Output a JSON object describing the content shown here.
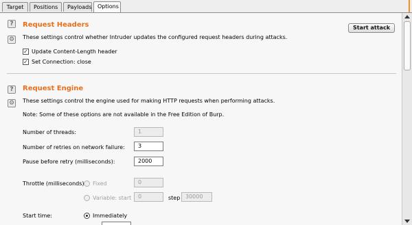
{
  "tabs": [
    {
      "label": "Target",
      "active": false
    },
    {
      "label": "Positions",
      "active": false
    },
    {
      "label": "Payloads",
      "active": false
    },
    {
      "label": "Options",
      "active": true
    }
  ],
  "request_headers": {
    "title": "Request Headers",
    "description": "These settings control whether Intruder updates the configured request headers during attacks.",
    "start_attack_label": "Start attack",
    "options": [
      {
        "label": "Update Content-Length header",
        "checked": true
      },
      {
        "label": "Set Connection: close",
        "checked": true
      }
    ]
  },
  "request_engine": {
    "title": "Request Engine",
    "description": "These settings control the engine used for making HTTP requests when performing attacks.",
    "note": "Note: Some of these options are not available in the Free Edition of Burp.",
    "threads_label": "Number of threads:",
    "threads_value": "1",
    "retries_label": "Number of retries on network failure:",
    "retries_value": "3",
    "pause_label": "Pause before retry (milliseconds):",
    "pause_value": "2000",
    "throttle_label": "Throttle (milliseconds):",
    "throttle_fixed_label": "Fixed",
    "throttle_fixed_value": "0",
    "throttle_variable_label": "Variable:  start",
    "throttle_variable_start": "0",
    "throttle_step_label": "step",
    "throttle_step_value": "30000",
    "start_time_label": "Start time:",
    "start_time_option": "Immediately"
  },
  "colors": {
    "accent": "#e8701a",
    "tab_indicator": "#ff8c1a"
  }
}
